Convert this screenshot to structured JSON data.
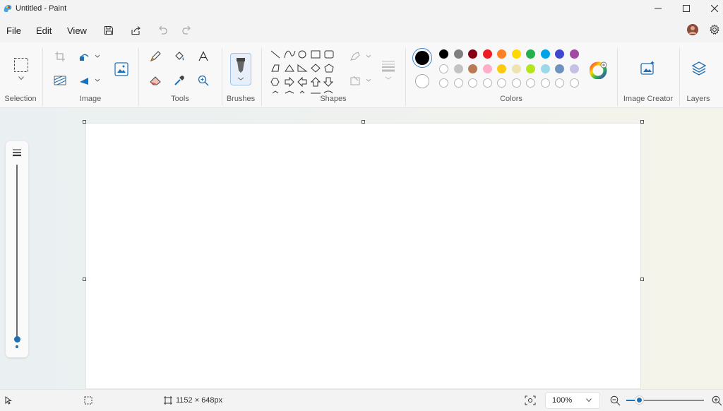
{
  "window": {
    "title": "Untitled - Paint"
  },
  "menu": {
    "file": "File",
    "edit": "Edit",
    "view": "View"
  },
  "ribbon": {
    "groups": {
      "selection": "Selection",
      "image": "Image",
      "tools": "Tools",
      "brushes": "Brushes",
      "shapes": "Shapes",
      "colors": "Colors",
      "image_creator": "Image Creator",
      "layers": "Layers"
    }
  },
  "colors": {
    "primary": "#000000",
    "secondary": "#ffffff",
    "row1": [
      "#000000",
      "#7f7f7f",
      "#880015",
      "#ed1c24",
      "#ff7f27",
      "#ffd800",
      "#22b14c",
      "#00a2e8",
      "#3f48cc",
      "#a349a4"
    ],
    "row2": [
      "#ffffff",
      "#c3c3c3",
      "#b97a57",
      "#ffaec9",
      "#ffc90e",
      "#efe4b0",
      "#b5e61d",
      "#99d9ea",
      "#7092be",
      "#c8bfe7"
    ],
    "row3_custom_empty": 10
  },
  "status": {
    "canvas_size": "1152 × 648px",
    "zoom": "100%"
  }
}
